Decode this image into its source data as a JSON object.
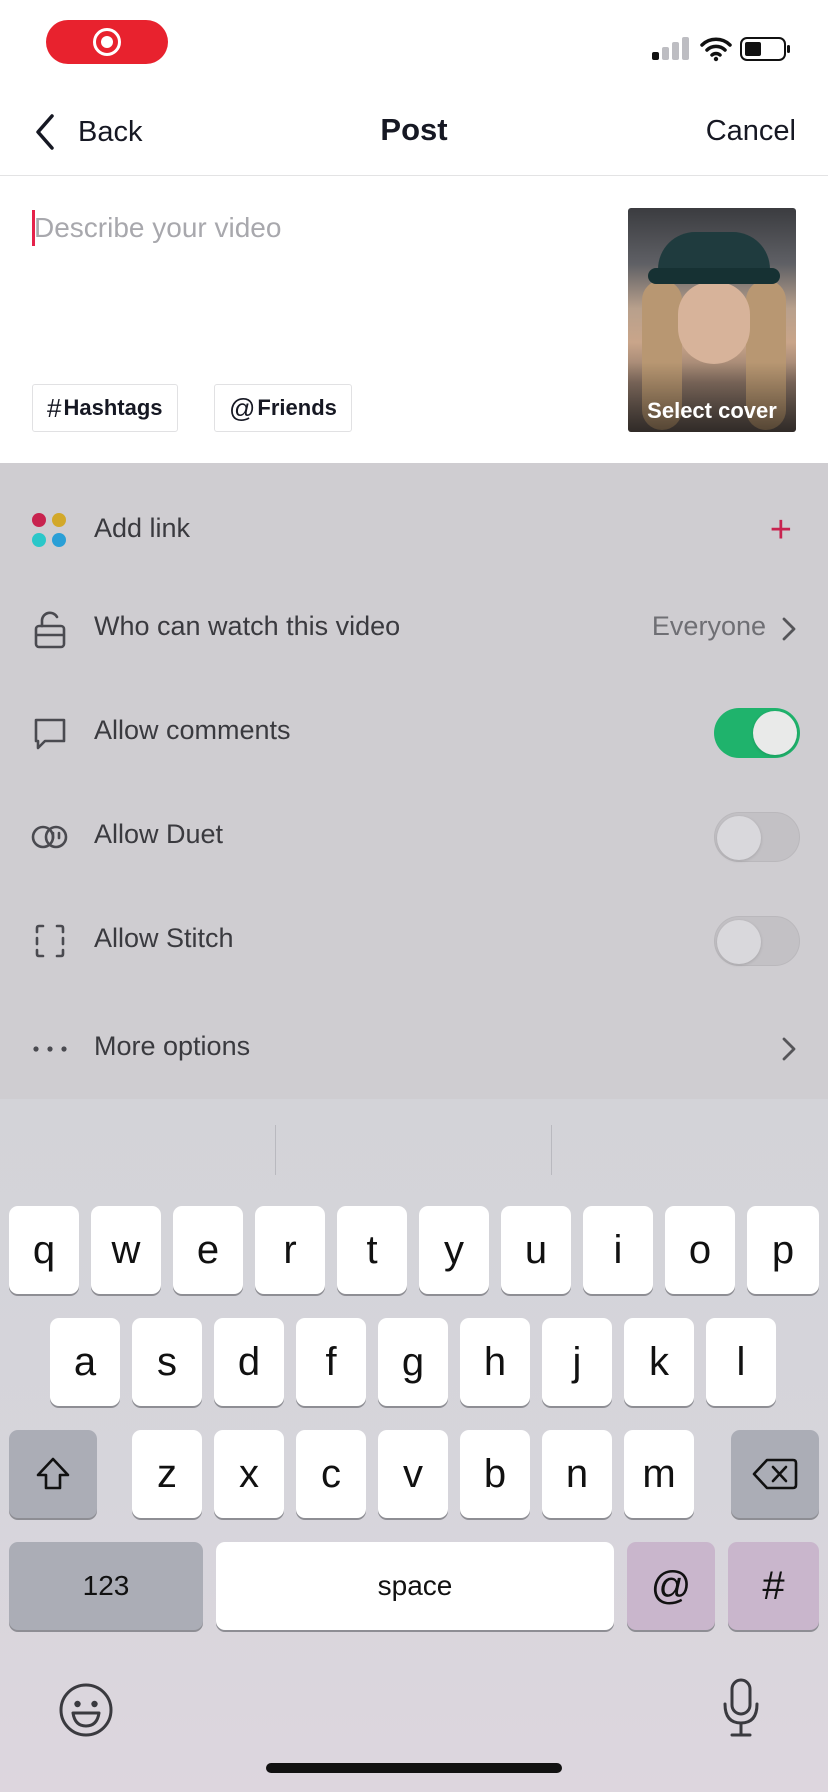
{
  "nav": {
    "back_label": "Back",
    "title": "Post",
    "cancel_label": "Cancel"
  },
  "description": {
    "placeholder": "Describe your video",
    "value": ""
  },
  "chips": [
    {
      "symbol": "#",
      "label": "Hashtags"
    },
    {
      "symbol": "@",
      "label": "Friends"
    }
  ],
  "cover": {
    "label": "Select cover"
  },
  "settings": {
    "add_link": {
      "label": "Add link",
      "action": "+"
    },
    "who_can_watch": {
      "label": "Who can watch this video",
      "value": "Everyone"
    },
    "allow_comments": {
      "label": "Allow comments",
      "enabled": true
    },
    "allow_duet": {
      "label": "Allow Duet",
      "enabled": false
    },
    "allow_stitch": {
      "label": "Allow Stitch",
      "enabled": false
    },
    "more_options": {
      "label": "More options"
    }
  },
  "keyboard": {
    "row1": [
      "q",
      "w",
      "e",
      "r",
      "t",
      "y",
      "u",
      "i",
      "o",
      "p"
    ],
    "row2": [
      "a",
      "s",
      "d",
      "f",
      "g",
      "h",
      "j",
      "k",
      "l"
    ],
    "row3": [
      "z",
      "x",
      "c",
      "v",
      "b",
      "n",
      "m"
    ],
    "numbers_key": "123",
    "space_key": "space",
    "at_key": "@",
    "hash_key": "#"
  },
  "colors": {
    "accent_pink": "#e5224a",
    "toggle_on": "#1fb36c",
    "record_red": "#e8222e"
  }
}
